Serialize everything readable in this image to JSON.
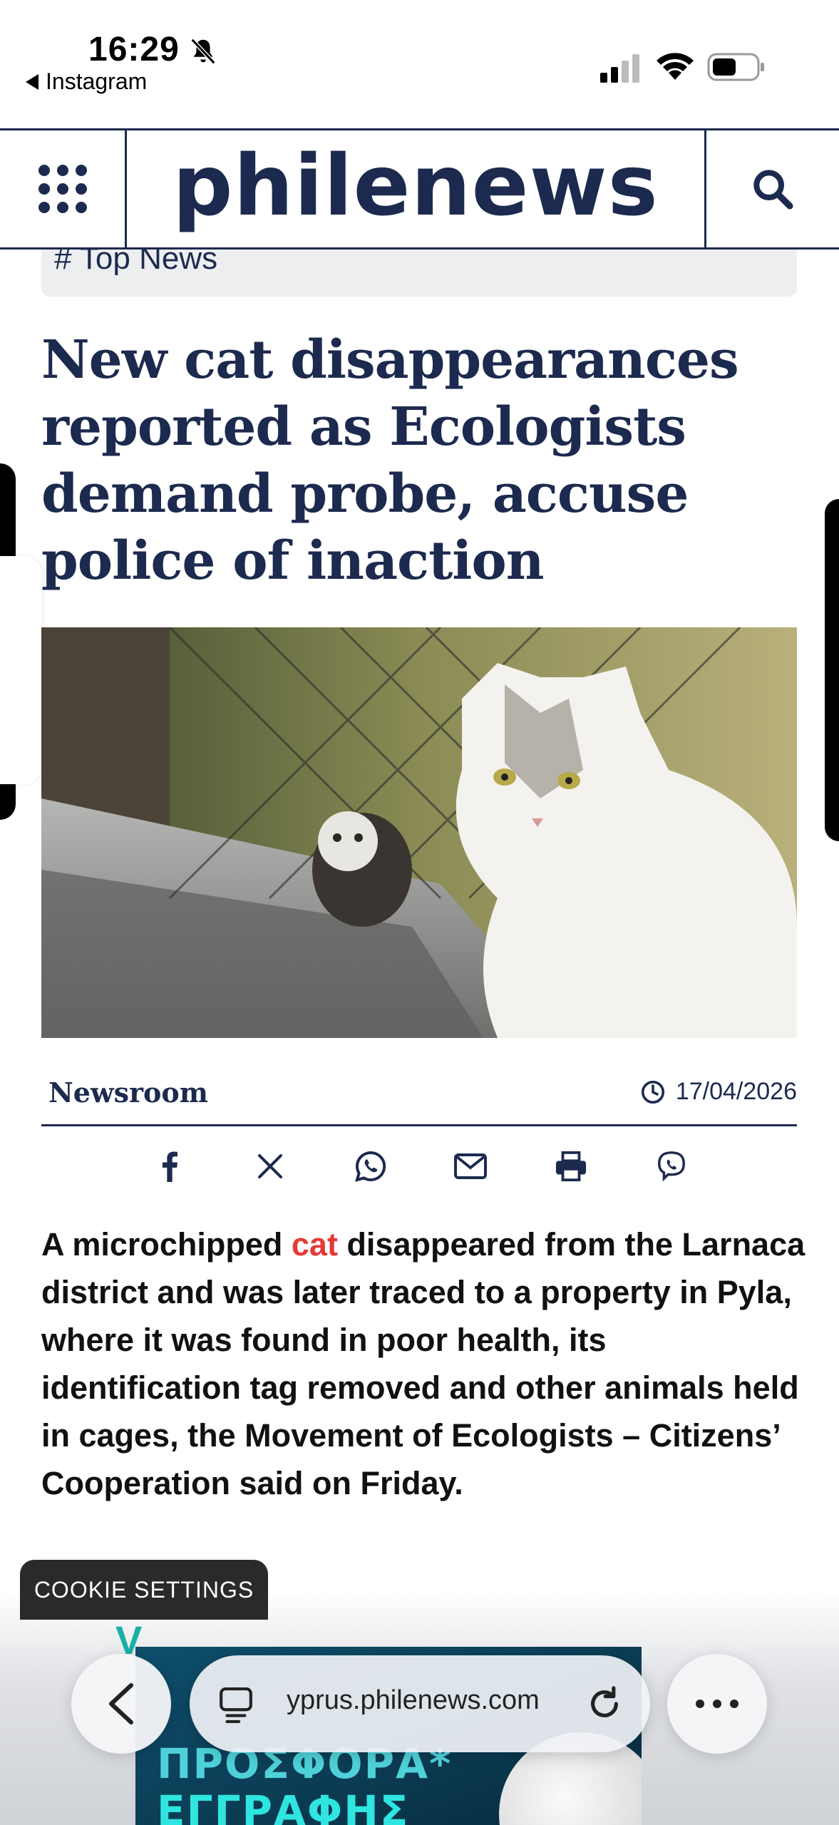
{
  "status_bar": {
    "time": "16:29",
    "back_app_label": "Instagram"
  },
  "header": {
    "logo_text": "philenews",
    "menu_icon": "grid-menu-icon",
    "search_icon": "search-icon"
  },
  "article": {
    "category": "#  Top News",
    "headline": "New cat disappearances reported as Ecologists demand probe, accuse police of inaction",
    "author": "Newsroom",
    "date": "17/04/2026",
    "body_before": "A microchipped ",
    "body_link": "cat",
    "body_after": " disappeared from the Larnaca district and was later traced to a property in Pyla, where it was found in poor health, its identification tag removed and other animals held in cages, the Movement of Ecologists – Citizens’ Cooperation said on Friday."
  },
  "share_icons": [
    "facebook-icon",
    "x-icon",
    "whatsapp-icon",
    "email-icon",
    "print-icon",
    "viber-icon"
  ],
  "cookie": {
    "label": "COOKIE SETTINGS"
  },
  "ad": {
    "line1": "ΠΡΟΣΦΟΡΑ*",
    "line2": "ΕΓΓΡΑΦΗΣ"
  },
  "browser": {
    "url": "yprus.philenews.com"
  },
  "colors": {
    "brand_navy": "#1d2a4f",
    "link_red": "#e53935"
  }
}
